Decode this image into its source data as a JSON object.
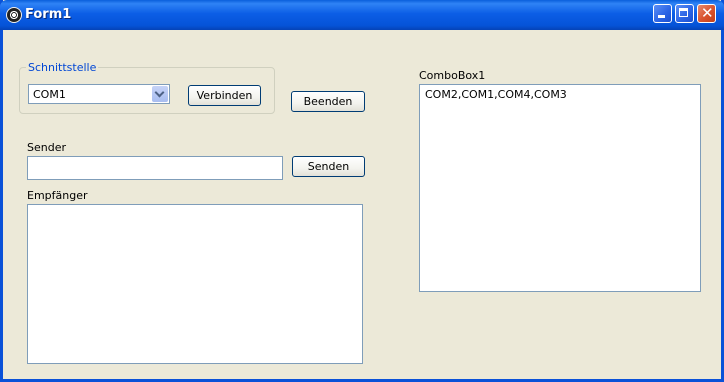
{
  "window": {
    "title": "Form1"
  },
  "groupbox": {
    "label": "Schnittstelle"
  },
  "combo": {
    "selected": "COM1"
  },
  "buttons": {
    "verbinden": "Verbinden",
    "beenden": "Beenden",
    "senden": "Senden"
  },
  "labels": {
    "sender": "Sender",
    "empfaenger": "Empfänger",
    "combobox1": "ComboBox1"
  },
  "inputs": {
    "sender_value": "",
    "empfaenger_value": ""
  },
  "listbox": {
    "items": [
      "COM2,COM1,COM4,COM3"
    ]
  },
  "colors": {
    "titlebar": "#0553d8",
    "window_bg": "#ece9d8",
    "group_label": "#0046d5",
    "close_button": "#d9532d"
  }
}
